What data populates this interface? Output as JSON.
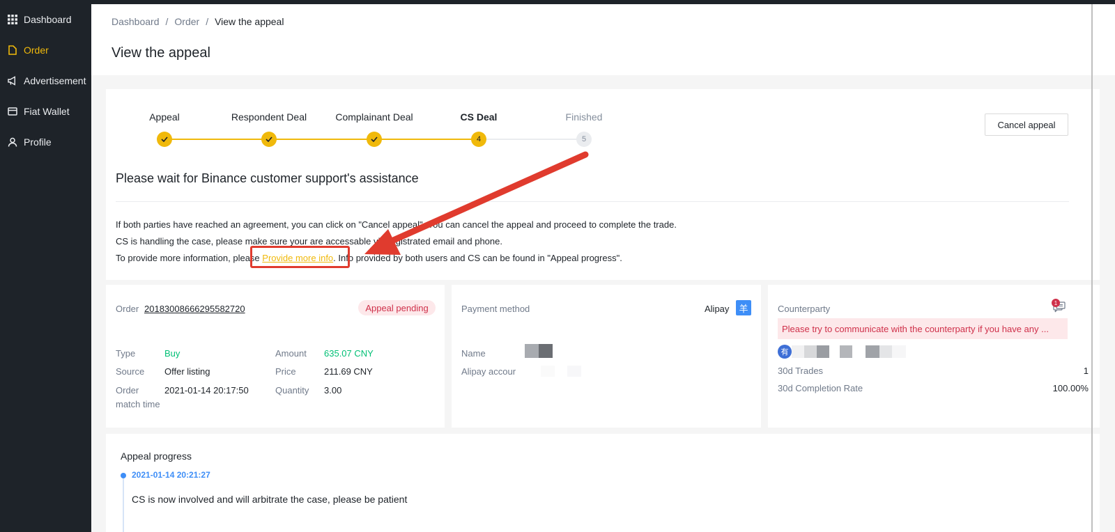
{
  "sidebar": {
    "items": [
      {
        "label": "Dashboard",
        "icon": "grid-icon"
      },
      {
        "label": "Order",
        "icon": "document-icon"
      },
      {
        "label": "Advertisement",
        "icon": "megaphone-icon"
      },
      {
        "label": "Fiat Wallet",
        "icon": "wallet-icon"
      },
      {
        "label": "Profile",
        "icon": "user-icon"
      }
    ]
  },
  "breadcrumb": {
    "items": [
      "Dashboard",
      "Order",
      "View the appeal"
    ],
    "separator": "/"
  },
  "page": {
    "title": "View the appeal"
  },
  "steps": [
    {
      "label": "Appeal",
      "status": "done"
    },
    {
      "label": "Respondent Deal",
      "status": "done"
    },
    {
      "label": "Complainant Deal",
      "status": "done"
    },
    {
      "label": "CS Deal",
      "status": "current",
      "number": "4"
    },
    {
      "label": "Finished",
      "status": "todo",
      "number": "5"
    }
  ],
  "cancel_button": "Cancel appeal",
  "notice": {
    "title": "Please wait for Binance customer support's assistance",
    "line1": "If both parties have reached an agreement, you can click on \"Cancel appeal\". You can cancel the appeal and proceed to complete the trade.",
    "line2": "CS is handling the case, please make sure your are accessable via registrated email and phone.",
    "line3_before": "To provide more information, please ",
    "line3_link": "Provide more info",
    "line3_after": ". Info provided by both users and CS can be found in \"Appeal progress\"."
  },
  "order": {
    "order_label": "Order",
    "order_no": "20183008666295582720",
    "status_badge": "Appeal pending",
    "type_label": "Type",
    "type_value": "Buy",
    "source_label": "Source",
    "source_value": "Offer listing",
    "match_label_1": "Order",
    "match_label_2": "match time",
    "match_value": "2021-01-14 20:17:50",
    "amount_label": "Amount",
    "amount_value": "635.07 CNY",
    "price_label": "Price",
    "price_value": "211.69 CNY",
    "quantity_label": "Quantity",
    "quantity_value": "3.00"
  },
  "payment": {
    "title": "Payment method",
    "method": "Alipay",
    "method_icon_glyph": "羊",
    "name_label": "Name",
    "account_label": "Alipay accour"
  },
  "counterparty": {
    "title": "Counterparty",
    "chat_badge": "1",
    "warning": "Please try to communicate with the counterparty if you have any ...",
    "avatar_char": "有",
    "trades_label": "30d Trades",
    "trades_value": "1",
    "rate_label": "30d Completion Rate",
    "rate_value": "100.00%"
  },
  "progress": {
    "title": "Appeal progress",
    "entries": [
      {
        "time": "2021-01-14 20:21:27",
        "text": "CS is now involved and will arbitrate the case, please be patient"
      }
    ]
  },
  "colors": {
    "brand": "#f0b90b",
    "sidebar_bg": "#1e2329",
    "danger": "#cf304a",
    "success": "#02c076",
    "link_blue": "#3e8ef7",
    "annotation": "#e03b2e"
  }
}
